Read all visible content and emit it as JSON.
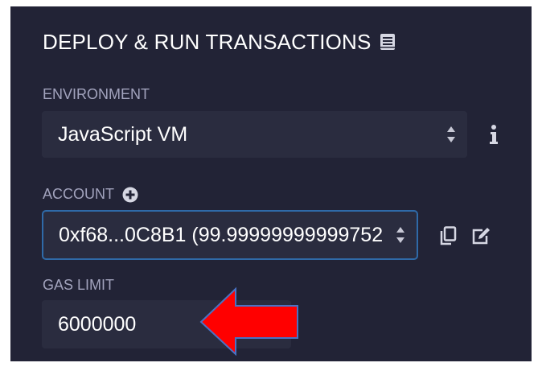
{
  "header": {
    "title": "DEPLOY & RUN TRANSACTIONS",
    "icon": "book-icon"
  },
  "environment": {
    "label": "ENVIRONMENT",
    "value": "JavaScript VM",
    "info_icon": "info-icon"
  },
  "account": {
    "label": "ACCOUNT",
    "add_icon": "plus-circle-icon",
    "value": "0xf68...0C8B1 (99.99999999999752",
    "copy_icon": "copy-icon",
    "edit_icon": "edit-icon"
  },
  "gas_limit": {
    "label": "GAS LIMIT",
    "value": "6000000"
  },
  "annotation": {
    "arrow_color": "#ff0000",
    "arrow_outline": "#4a72c4"
  },
  "colors": {
    "panel_bg": "#222336",
    "field_bg": "#2a2c3f",
    "label": "#a2a3bd",
    "focus_border": "#2f6aa8",
    "text": "#ffffff"
  }
}
